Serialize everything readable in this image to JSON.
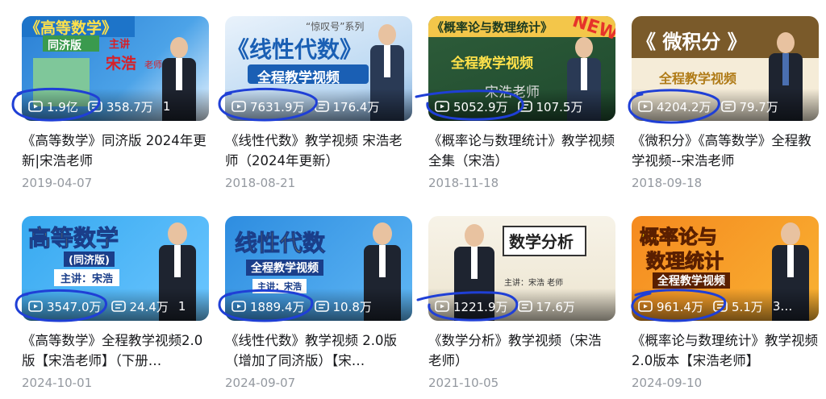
{
  "videos": [
    {
      "views": "1.9亿",
      "danmaku": "358.7万",
      "extra": "1",
      "title": "《高等数学》同济版 2024年更新|宋浩老师",
      "date": "2019-04-07",
      "thumb_main": "《高等数学》",
      "thumb_sub": "同济版",
      "thumb_tag": "主讲",
      "thumb_name": "宋浩",
      "thumb_role": "老师"
    },
    {
      "views": "7631.9万",
      "danmaku": "176.4万",
      "extra": "",
      "title": "《线性代数》教学视频 宋浩老师（2024年更新）",
      "date": "2018-08-21",
      "thumb_main": "《线性代数》",
      "thumb_sub": "全程教学视频",
      "thumb_tag": "“惊叹号”系列"
    },
    {
      "views": "5052.9万",
      "danmaku": "107.5万",
      "extra": "",
      "title": "《概率论与数理统计》教学视频全集（宋浩）",
      "date": "2018-11-18",
      "thumb_main": "《概率论与数理统计》",
      "thumb_sub": "全程教学视频",
      "thumb_tag": "NEW",
      "thumb_name": "宋浩老师"
    },
    {
      "views": "4204.2万",
      "danmaku": "79.7万",
      "extra": "",
      "title": "《微积分》《高等数学》全程教学视频--宋浩老师",
      "date": "2018-09-18",
      "thumb_main": "《 微积分 》",
      "thumb_sub": "全程教学视频"
    },
    {
      "views": "3547.0万",
      "danmaku": "24.4万",
      "extra": "1",
      "title": "《高等数学》全程教学视频2.0版【宋浩老师】（下册…",
      "date": "2024-10-01",
      "thumb_main": "高等数学",
      "thumb_sub": "(同济版)",
      "thumb_tag": "主讲：宋浩"
    },
    {
      "views": "1889.4万",
      "danmaku": "10.8万",
      "extra": "",
      "title": "《线性代数》教学视频 2.0版（增加了同济版）【宋…",
      "date": "2024-09-07",
      "thumb_main": "线性代数",
      "thumb_sub": "全程教学视频",
      "thumb_tag": "主讲：宋浩"
    },
    {
      "views": "1221.9万",
      "danmaku": "17.6万",
      "extra": "",
      "title": "《数学分析》教学视频（宋浩 老师）",
      "date": "2021-10-05",
      "thumb_main": "数学分析",
      "thumb_tag": "主讲：宋浩 老师"
    },
    {
      "views": "961.4万",
      "danmaku": "5.1万",
      "extra": "3…",
      "title": "《概率论与数理统计》教学视频 2.0版本【宋浩老师】",
      "date": "2024-09-10",
      "thumb_main": "概率论与",
      "thumb_sub": "数理统计",
      "thumb_tag": "全程教学视频"
    }
  ],
  "colors": {
    "annotation": "#1f3fd6",
    "date": "#9499a0",
    "title": "#18191c"
  },
  "icons": {
    "play": "play-icon",
    "danmaku": "danmaku-icon"
  }
}
